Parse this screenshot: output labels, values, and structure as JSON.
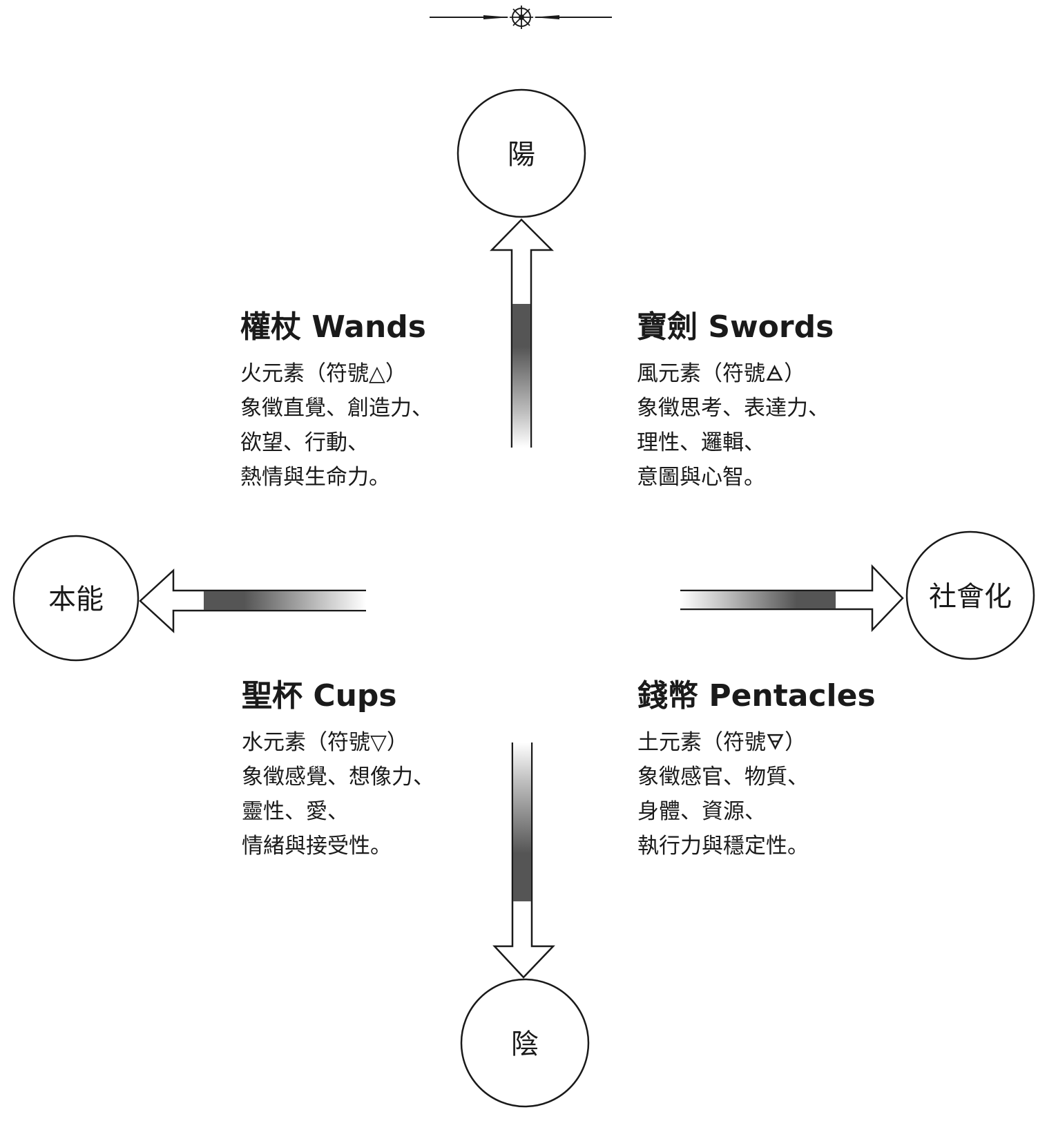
{
  "nodes": {
    "yang": "陽",
    "yin": "陰",
    "instinct": "本能",
    "socialization": "社會化"
  },
  "suits": {
    "wands": {
      "title": "權杖 Wands",
      "lines": [
        "火元素（符號△）",
        "象徵直覺、創造力、",
        "欲望、行動、",
        "熱情與生命力。"
      ]
    },
    "swords": {
      "title": "寶劍 Swords",
      "lines": [
        "風元素（符號🜁）",
        "象徵思考、表達力、",
        "理性、邏輯、",
        "意圖與心智。"
      ]
    },
    "cups": {
      "title": "聖杯 Cups",
      "lines": [
        "水元素（符號▽）",
        "象徵感覺、想像力、",
        "靈性、愛、",
        "情緒與接受性。"
      ]
    },
    "pentacles": {
      "title": "錢幣 Pentacles",
      "lines": [
        "土元素（符號🜃）",
        "象徵感官、物質、",
        "身體、資源、",
        "執行力與穩定性。"
      ]
    }
  },
  "colors": {
    "ink": "#1a1a1a",
    "paper": "#ffffff"
  },
  "icons": {
    "ornament": "compass-wheel-icon"
  }
}
